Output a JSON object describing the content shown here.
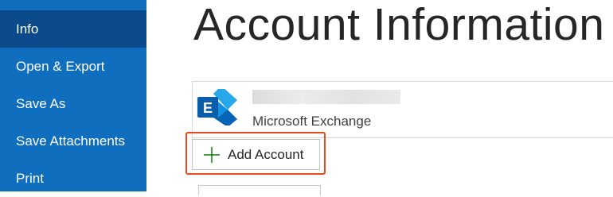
{
  "sidebar": {
    "items": [
      {
        "label": "Info",
        "active": true
      },
      {
        "label": "Open & Export",
        "active": false
      },
      {
        "label": "Save As",
        "active": false
      },
      {
        "label": "Save Attachments",
        "active": false
      },
      {
        "label": "Print",
        "active": false
      }
    ]
  },
  "main": {
    "title": "Account Information",
    "account": {
      "type": "Microsoft Exchange",
      "icon": "exchange-icon"
    },
    "add_account_label": "Add Account"
  },
  "colors": {
    "sidebar_bg": "#106ebe",
    "sidebar_active_bg": "#0b4b8c",
    "highlight_border": "#e8491e",
    "plus_green": "#107c10"
  }
}
